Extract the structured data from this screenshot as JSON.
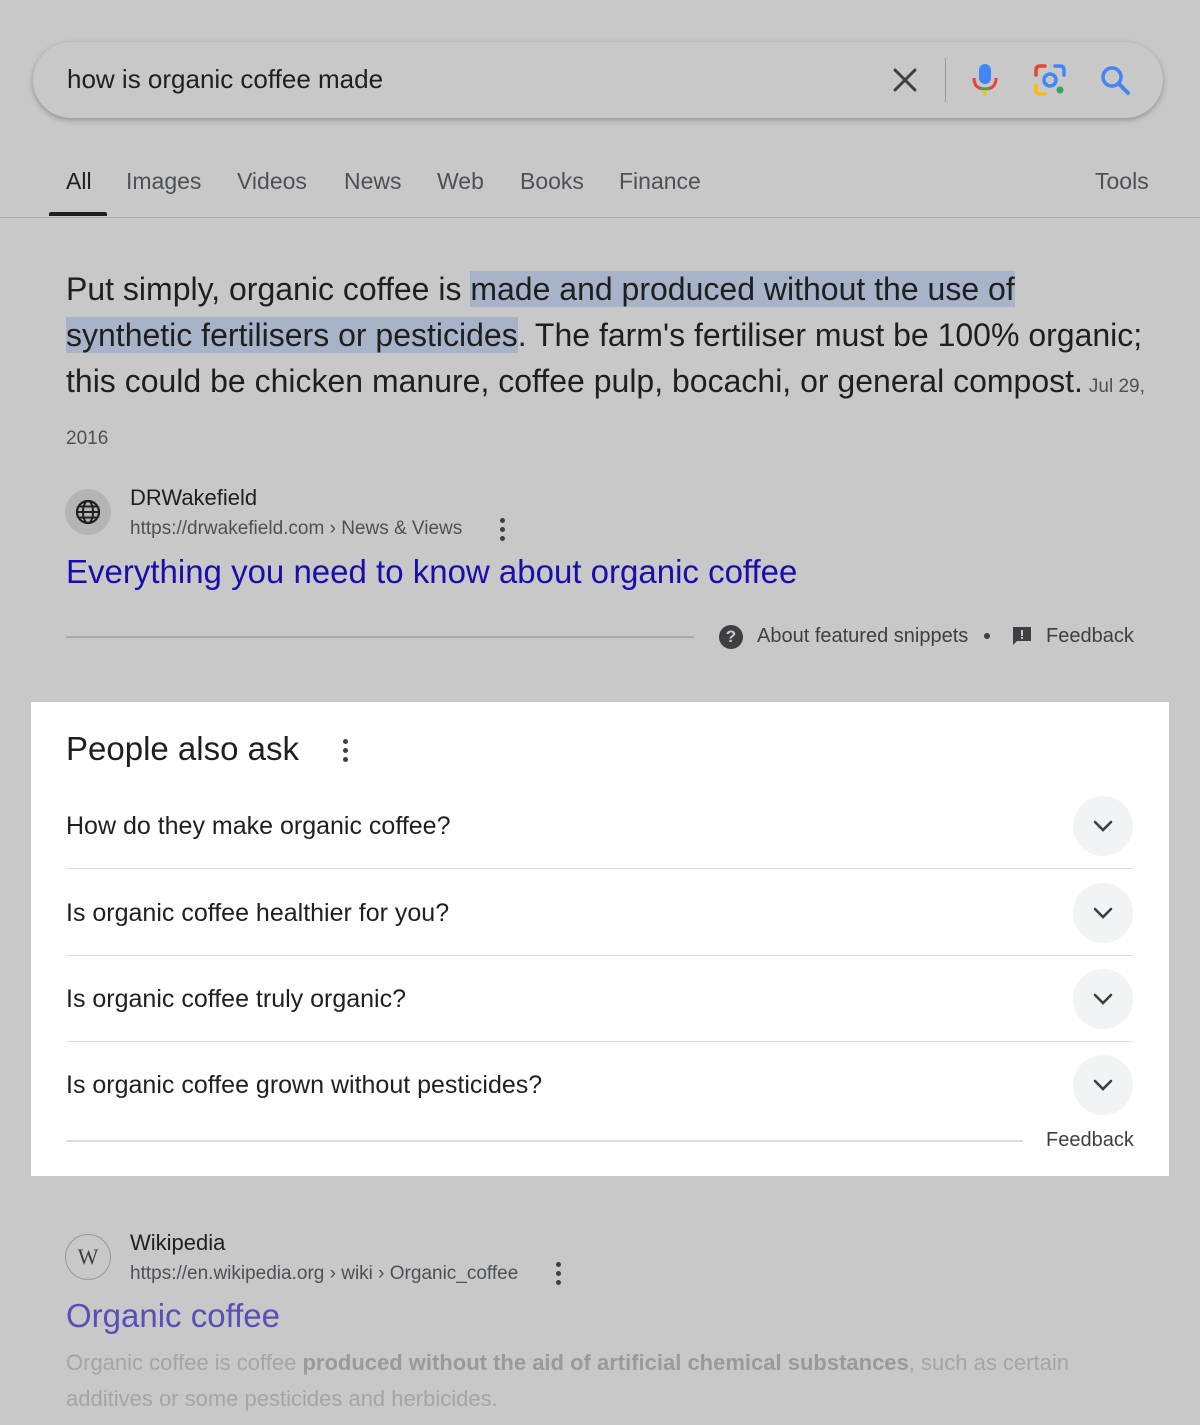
{
  "search": {
    "query": "how is organic coffee made",
    "clear_icon": "close-icon",
    "voice_icon": "microphone-icon",
    "lens_icon": "lens-camera-icon",
    "search_icon": "search-icon"
  },
  "tabs": {
    "items": [
      "All",
      "Images",
      "Videos",
      "News",
      "Web",
      "Books",
      "Finance"
    ],
    "active": "All",
    "tools": "Tools"
  },
  "featured_snippet": {
    "text_before": "Put simply, organic coffee is ",
    "highlighted": "made and produced without the use of synthetic fertilisers or pesticides",
    "text_after": ". The farm's fertiliser must be 100% organic; this could be chicken manure, coffee pulp, bocachi, or general compost.",
    "date": "Jul 29, 2016",
    "source_name": "DRWakefield",
    "source_url": "https://drwakefield.com › News & Views",
    "result_title": "Everything you need to know about organic coffee",
    "about_label": "About featured snippets",
    "feedback_label": "Feedback"
  },
  "people_also_ask": {
    "title": "People also ask",
    "questions": [
      "How do they make organic coffee?",
      "Is organic coffee healthier for you?",
      "Is organic coffee truly organic?",
      "Is organic coffee grown without pesticides?"
    ],
    "feedback_label": "Feedback"
  },
  "wikipedia_result": {
    "source_name": "Wikipedia",
    "source_url": "https://en.wikipedia.org › wiki › Organic_coffee",
    "title": "Organic coffee",
    "snippet_start": "Organic coffee is coffee ",
    "snippet_bold": "produced without the aid of artificial chemical substances",
    "snippet_end": ", such as certain additives or some pesticides and herbicides."
  },
  "colors": {
    "link": "#1a0dab",
    "visited_link": "#5a4fb8",
    "highlight": "#a6b3c8",
    "overlay_bg": "#c8c8c8"
  }
}
